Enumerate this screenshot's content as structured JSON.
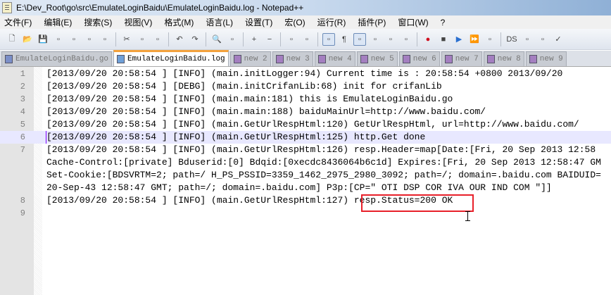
{
  "window": {
    "title": "E:\\Dev_Root\\go\\src\\EmulateLoginBaidu\\EmulateLoginBaidu.log - Notepad++"
  },
  "menu": [
    "文件(F)",
    "编辑(E)",
    "搜索(S)",
    "视图(V)",
    "格式(M)",
    "语言(L)",
    "设置(T)",
    "宏(O)",
    "运行(R)",
    "插件(P)",
    "窗口(W)",
    "?"
  ],
  "toolbar": {
    "buttons": [
      "new-file",
      "open-file",
      "save",
      "save-all",
      "close",
      "close-all",
      "print",
      "cut",
      "copy",
      "paste",
      "undo",
      "redo",
      "find",
      "replace",
      "zoom-in",
      "zoom-out",
      "sync-vertical",
      "sync-horizontal",
      "word-wrap",
      "show-all-chars",
      "indent-guide",
      "user-language",
      "doc-map",
      "function-list",
      "record-macro",
      "stop-macro",
      "play-macro",
      "run-macro-multiple",
      "save-macro",
      "DS",
      "plugin1",
      "plugin2",
      "spell-check"
    ],
    "active": [
      "word-wrap",
      "indent-guide"
    ]
  },
  "tabs": [
    {
      "label": "EmulateLoginBaidu.go",
      "active": false
    },
    {
      "label": "EmulateLoginBaidu.log",
      "active": true
    },
    {
      "label": "new  2"
    },
    {
      "label": "new  3"
    },
    {
      "label": "new  4"
    },
    {
      "label": "new  5"
    },
    {
      "label": "new  6"
    },
    {
      "label": "new  7"
    },
    {
      "label": "new  8"
    },
    {
      "label": "new  9"
    }
  ],
  "editor": {
    "current_line": 6,
    "rows": [
      {
        "ln": "1",
        "text": "[2013/09/20 20:58:54 ] [INFO] (main.initLogger:94) Current time is : 20:58:54 +0800 2013/09/20"
      },
      {
        "ln": "2",
        "text": "[2013/09/20 20:58:54 ] [DEBG] (main.initCrifanLib:68) init for crifanLib"
      },
      {
        "ln": "3",
        "text": "[2013/09/20 20:58:54 ] [INFO] (main.main:181) this is EmulateLoginBaidu.go"
      },
      {
        "ln": "4",
        "text": "[2013/09/20 20:58:54 ] [INFO] (main.main:188) baiduMainUrl=http://www.baidu.com/"
      },
      {
        "ln": "5",
        "text": "[2013/09/20 20:58:54 ] [INFO] (main.GetUrlRespHtml:120) GetUrlRespHtml, url=http://www.baidu.com/"
      },
      {
        "ln": "6",
        "text": "[2013/09/20 20:58:54 ] [INFO] (main.GetUrlRespHtml:125) http.Get done"
      },
      {
        "ln": "7",
        "text": "[2013/09/20 20:58:54 ] [INFO] (main.GetUrlRespHtml:126) resp.Header=map[Date:[Fri, 20 Sep 2013 12:58"
      },
      {
        "ln": "",
        "text": "Cache-Control:[private] Bduserid:[0] Bdqid:[0xecdc8436064b6c1d] Expires:[Fri, 20 Sep 2013 12:58:47 GM"
      },
      {
        "ln": "",
        "text": "Set-Cookie:[BDSVRTM=2; path=/ H_PS_PSSID=3359_1462_2975_2980_3092; path=/; domain=.baidu.com BAIDUID="
      },
      {
        "ln": "",
        "text": "20-Sep-43 12:58:47 GMT; path=/; domain=.baidu.com] P3p:[CP=\" OTI DSP COR IVA OUR IND COM \"]]"
      },
      {
        "ln": "8",
        "text": "[2013/09/20 20:58:54 ] [INFO] (main.GetUrlRespHtml:127) resp.Status=200 OK"
      },
      {
        "ln": "9",
        "text": ""
      }
    ]
  },
  "colors": {
    "highlight_box": "#e8202a",
    "current_line": "#e8e8ff",
    "active_tab_accent": "#f4a23c"
  }
}
